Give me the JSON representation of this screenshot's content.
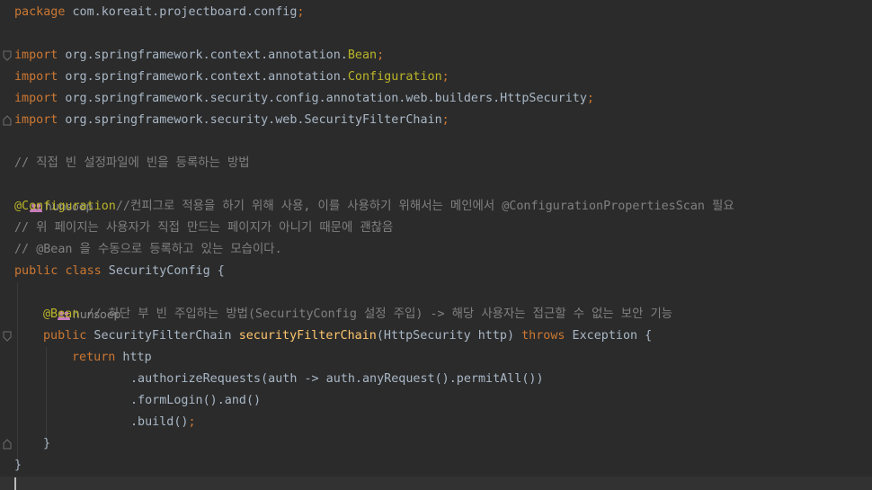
{
  "editor": {
    "colors": {
      "background": "#2b2b2b",
      "keyword": "#cc7832",
      "annotation": "#bbb529",
      "comment": "#808080",
      "method": "#ffc66d",
      "text": "#a9b7c6",
      "author_icon": "#c77dbb"
    },
    "author_hint": "hunsoep",
    "author_icon": "users-icon",
    "lines": {
      "l1_kw": "package",
      "l1_rest": " com.koreait.projectboard.config",
      "l1_semi": ";",
      "import_kw": "import",
      "l4_pre": " org.springframework.context.annotation.",
      "l4_cls": "Bean",
      "l5_pre": " org.springframework.context.annotation.",
      "l5_cls": "Configuration",
      "l6_pre": " org.springframework.security.config.annotation.web.builders.HttpSecurity",
      "l7_pre": " org.springframework.security.web.SecurityFilterChain",
      "semi": ";",
      "l9_comment": "// 직접 빈 설정파일에 빈을 등록하는 방법",
      "l11_ann": "@Configuration",
      "l11_comment_a": "//컨피그로 적용을 하기 위해 사용, 이를 사용하기 위해서는 메인에서 ",
      "l11_comment_ann": "@ConfigurationPropertiesScan",
      "l11_comment_b": " 필요",
      "l12_comment": "// 위 페이지는 사용자가 직접 만드는 페이지가 아니기 때문에 괜찮음",
      "l13_comment_a": "// ",
      "l13_comment_ann": "@Bean",
      "l13_comment_b": " 을 수동으로 등록하고 있는 모습이다.",
      "l14_kw1": "public",
      "l14_kw2": "class",
      "l14_rest": " SecurityConfig {",
      "l16_ann": "@Bean",
      "l16_comment": " // 하단 부 빈 주입하는 방법(SecurityConfig 설정 주입) -> 해당 사용자는 접근할 수 없는 보안 기능",
      "l17_kw": "public",
      "l17_type": " SecurityFilterChain ",
      "l17_method": "securityFilterChain",
      "l17_params": "(HttpSecurity http) ",
      "l17_throws": "throws",
      "l17_rest": " Exception {",
      "l18_kw": "return",
      "l18_rest": " http",
      "l19": ".authorizeRequests(auth -> auth.anyRequest().permitAll())",
      "l20": ".formLogin().and()",
      "l21_a": ".build()",
      "l21_semi": ";",
      "l22": "}",
      "l23": "}"
    }
  }
}
